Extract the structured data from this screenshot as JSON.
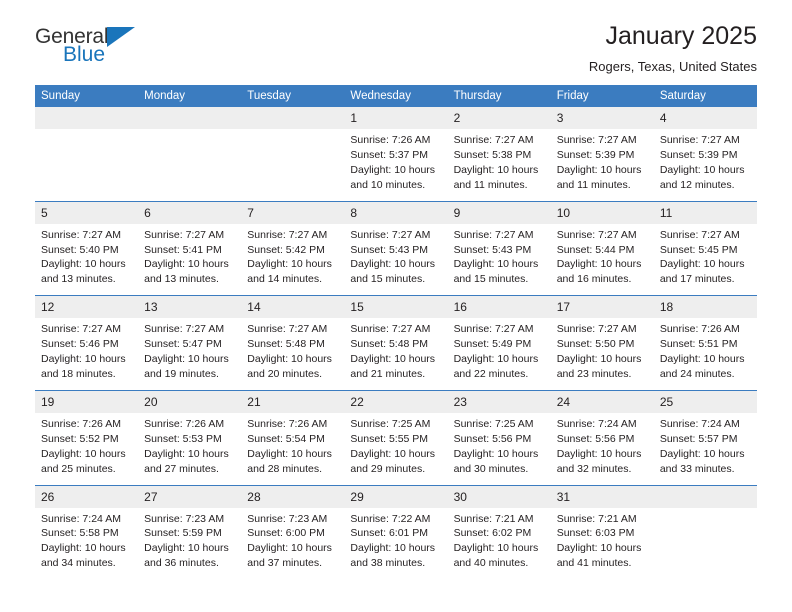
{
  "brand": {
    "name_part1": "General",
    "name_part2": "Blue",
    "accent_color": "#1a75bb"
  },
  "header": {
    "title": "January 2025",
    "subtitle": "Rogers, Texas, United States"
  },
  "calendar": {
    "header_color": "#3b7cc0",
    "daynum_bg": "#eeeeee",
    "weekday_names": [
      "Sunday",
      "Monday",
      "Tuesday",
      "Wednesday",
      "Thursday",
      "Friday",
      "Saturday"
    ],
    "weeks": [
      [
        {
          "day": "",
          "lines": []
        },
        {
          "day": "",
          "lines": []
        },
        {
          "day": "",
          "lines": []
        },
        {
          "day": "1",
          "lines": [
            "Sunrise: 7:26 AM",
            "Sunset: 5:37 PM",
            "Daylight: 10 hours",
            "and 10 minutes."
          ]
        },
        {
          "day": "2",
          "lines": [
            "Sunrise: 7:27 AM",
            "Sunset: 5:38 PM",
            "Daylight: 10 hours",
            "and 11 minutes."
          ]
        },
        {
          "day": "3",
          "lines": [
            "Sunrise: 7:27 AM",
            "Sunset: 5:39 PM",
            "Daylight: 10 hours",
            "and 11 minutes."
          ]
        },
        {
          "day": "4",
          "lines": [
            "Sunrise: 7:27 AM",
            "Sunset: 5:39 PM",
            "Daylight: 10 hours",
            "and 12 minutes."
          ]
        }
      ],
      [
        {
          "day": "5",
          "lines": [
            "Sunrise: 7:27 AM",
            "Sunset: 5:40 PM",
            "Daylight: 10 hours",
            "and 13 minutes."
          ]
        },
        {
          "day": "6",
          "lines": [
            "Sunrise: 7:27 AM",
            "Sunset: 5:41 PM",
            "Daylight: 10 hours",
            "and 13 minutes."
          ]
        },
        {
          "day": "7",
          "lines": [
            "Sunrise: 7:27 AM",
            "Sunset: 5:42 PM",
            "Daylight: 10 hours",
            "and 14 minutes."
          ]
        },
        {
          "day": "8",
          "lines": [
            "Sunrise: 7:27 AM",
            "Sunset: 5:43 PM",
            "Daylight: 10 hours",
            "and 15 minutes."
          ]
        },
        {
          "day": "9",
          "lines": [
            "Sunrise: 7:27 AM",
            "Sunset: 5:43 PM",
            "Daylight: 10 hours",
            "and 15 minutes."
          ]
        },
        {
          "day": "10",
          "lines": [
            "Sunrise: 7:27 AM",
            "Sunset: 5:44 PM",
            "Daylight: 10 hours",
            "and 16 minutes."
          ]
        },
        {
          "day": "11",
          "lines": [
            "Sunrise: 7:27 AM",
            "Sunset: 5:45 PM",
            "Daylight: 10 hours",
            "and 17 minutes."
          ]
        }
      ],
      [
        {
          "day": "12",
          "lines": [
            "Sunrise: 7:27 AM",
            "Sunset: 5:46 PM",
            "Daylight: 10 hours",
            "and 18 minutes."
          ]
        },
        {
          "day": "13",
          "lines": [
            "Sunrise: 7:27 AM",
            "Sunset: 5:47 PM",
            "Daylight: 10 hours",
            "and 19 minutes."
          ]
        },
        {
          "day": "14",
          "lines": [
            "Sunrise: 7:27 AM",
            "Sunset: 5:48 PM",
            "Daylight: 10 hours",
            "and 20 minutes."
          ]
        },
        {
          "day": "15",
          "lines": [
            "Sunrise: 7:27 AM",
            "Sunset: 5:48 PM",
            "Daylight: 10 hours",
            "and 21 minutes."
          ]
        },
        {
          "day": "16",
          "lines": [
            "Sunrise: 7:27 AM",
            "Sunset: 5:49 PM",
            "Daylight: 10 hours",
            "and 22 minutes."
          ]
        },
        {
          "day": "17",
          "lines": [
            "Sunrise: 7:27 AM",
            "Sunset: 5:50 PM",
            "Daylight: 10 hours",
            "and 23 minutes."
          ]
        },
        {
          "day": "18",
          "lines": [
            "Sunrise: 7:26 AM",
            "Sunset: 5:51 PM",
            "Daylight: 10 hours",
            "and 24 minutes."
          ]
        }
      ],
      [
        {
          "day": "19",
          "lines": [
            "Sunrise: 7:26 AM",
            "Sunset: 5:52 PM",
            "Daylight: 10 hours",
            "and 25 minutes."
          ]
        },
        {
          "day": "20",
          "lines": [
            "Sunrise: 7:26 AM",
            "Sunset: 5:53 PM",
            "Daylight: 10 hours",
            "and 27 minutes."
          ]
        },
        {
          "day": "21",
          "lines": [
            "Sunrise: 7:26 AM",
            "Sunset: 5:54 PM",
            "Daylight: 10 hours",
            "and 28 minutes."
          ]
        },
        {
          "day": "22",
          "lines": [
            "Sunrise: 7:25 AM",
            "Sunset: 5:55 PM",
            "Daylight: 10 hours",
            "and 29 minutes."
          ]
        },
        {
          "day": "23",
          "lines": [
            "Sunrise: 7:25 AM",
            "Sunset: 5:56 PM",
            "Daylight: 10 hours",
            "and 30 minutes."
          ]
        },
        {
          "day": "24",
          "lines": [
            "Sunrise: 7:24 AM",
            "Sunset: 5:56 PM",
            "Daylight: 10 hours",
            "and 32 minutes."
          ]
        },
        {
          "day": "25",
          "lines": [
            "Sunrise: 7:24 AM",
            "Sunset: 5:57 PM",
            "Daylight: 10 hours",
            "and 33 minutes."
          ]
        }
      ],
      [
        {
          "day": "26",
          "lines": [
            "Sunrise: 7:24 AM",
            "Sunset: 5:58 PM",
            "Daylight: 10 hours",
            "and 34 minutes."
          ]
        },
        {
          "day": "27",
          "lines": [
            "Sunrise: 7:23 AM",
            "Sunset: 5:59 PM",
            "Daylight: 10 hours",
            "and 36 minutes."
          ]
        },
        {
          "day": "28",
          "lines": [
            "Sunrise: 7:23 AM",
            "Sunset: 6:00 PM",
            "Daylight: 10 hours",
            "and 37 minutes."
          ]
        },
        {
          "day": "29",
          "lines": [
            "Sunrise: 7:22 AM",
            "Sunset: 6:01 PM",
            "Daylight: 10 hours",
            "and 38 minutes."
          ]
        },
        {
          "day": "30",
          "lines": [
            "Sunrise: 7:21 AM",
            "Sunset: 6:02 PM",
            "Daylight: 10 hours",
            "and 40 minutes."
          ]
        },
        {
          "day": "31",
          "lines": [
            "Sunrise: 7:21 AM",
            "Sunset: 6:03 PM",
            "Daylight: 10 hours",
            "and 41 minutes."
          ]
        },
        {
          "day": "",
          "lines": []
        }
      ]
    ]
  }
}
